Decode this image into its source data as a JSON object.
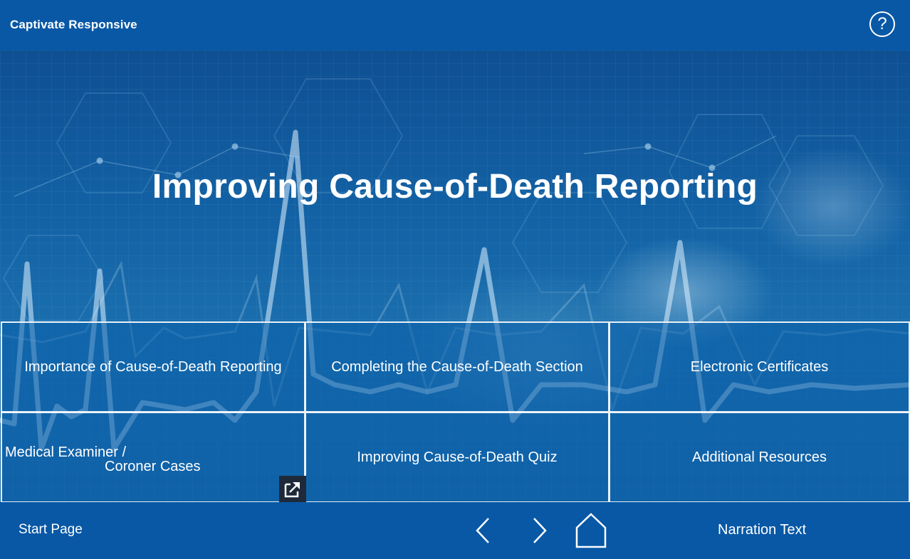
{
  "header": {
    "app_title": "Captivate Responsive",
    "help_label": "?"
  },
  "hero": {
    "title": "Improving Cause-of-Death Reporting"
  },
  "tiles": [
    {
      "label": "Importance of Cause-of-Death Reporting"
    },
    {
      "label": "Completing the Cause-of-Death Section"
    },
    {
      "label": "Electronic Certificates"
    },
    {
      "label_line1": "Medical Examiner /",
      "label_line2": "Coroner Cases"
    },
    {
      "label": "Improving Cause-of-Death Quiz"
    },
    {
      "label": "Additional Resources"
    }
  ],
  "footer": {
    "start_page": "Start Page",
    "narration": "Narration Text"
  },
  "icons": {
    "help": "help-icon",
    "external_link": "external-link-icon",
    "previous": "chevron-left-icon",
    "next": "chevron-right-icon",
    "home": "home-icon"
  },
  "colors": {
    "header_bg": "#0858a6",
    "hero_bg": "#1363a6",
    "text": "#ffffff"
  }
}
